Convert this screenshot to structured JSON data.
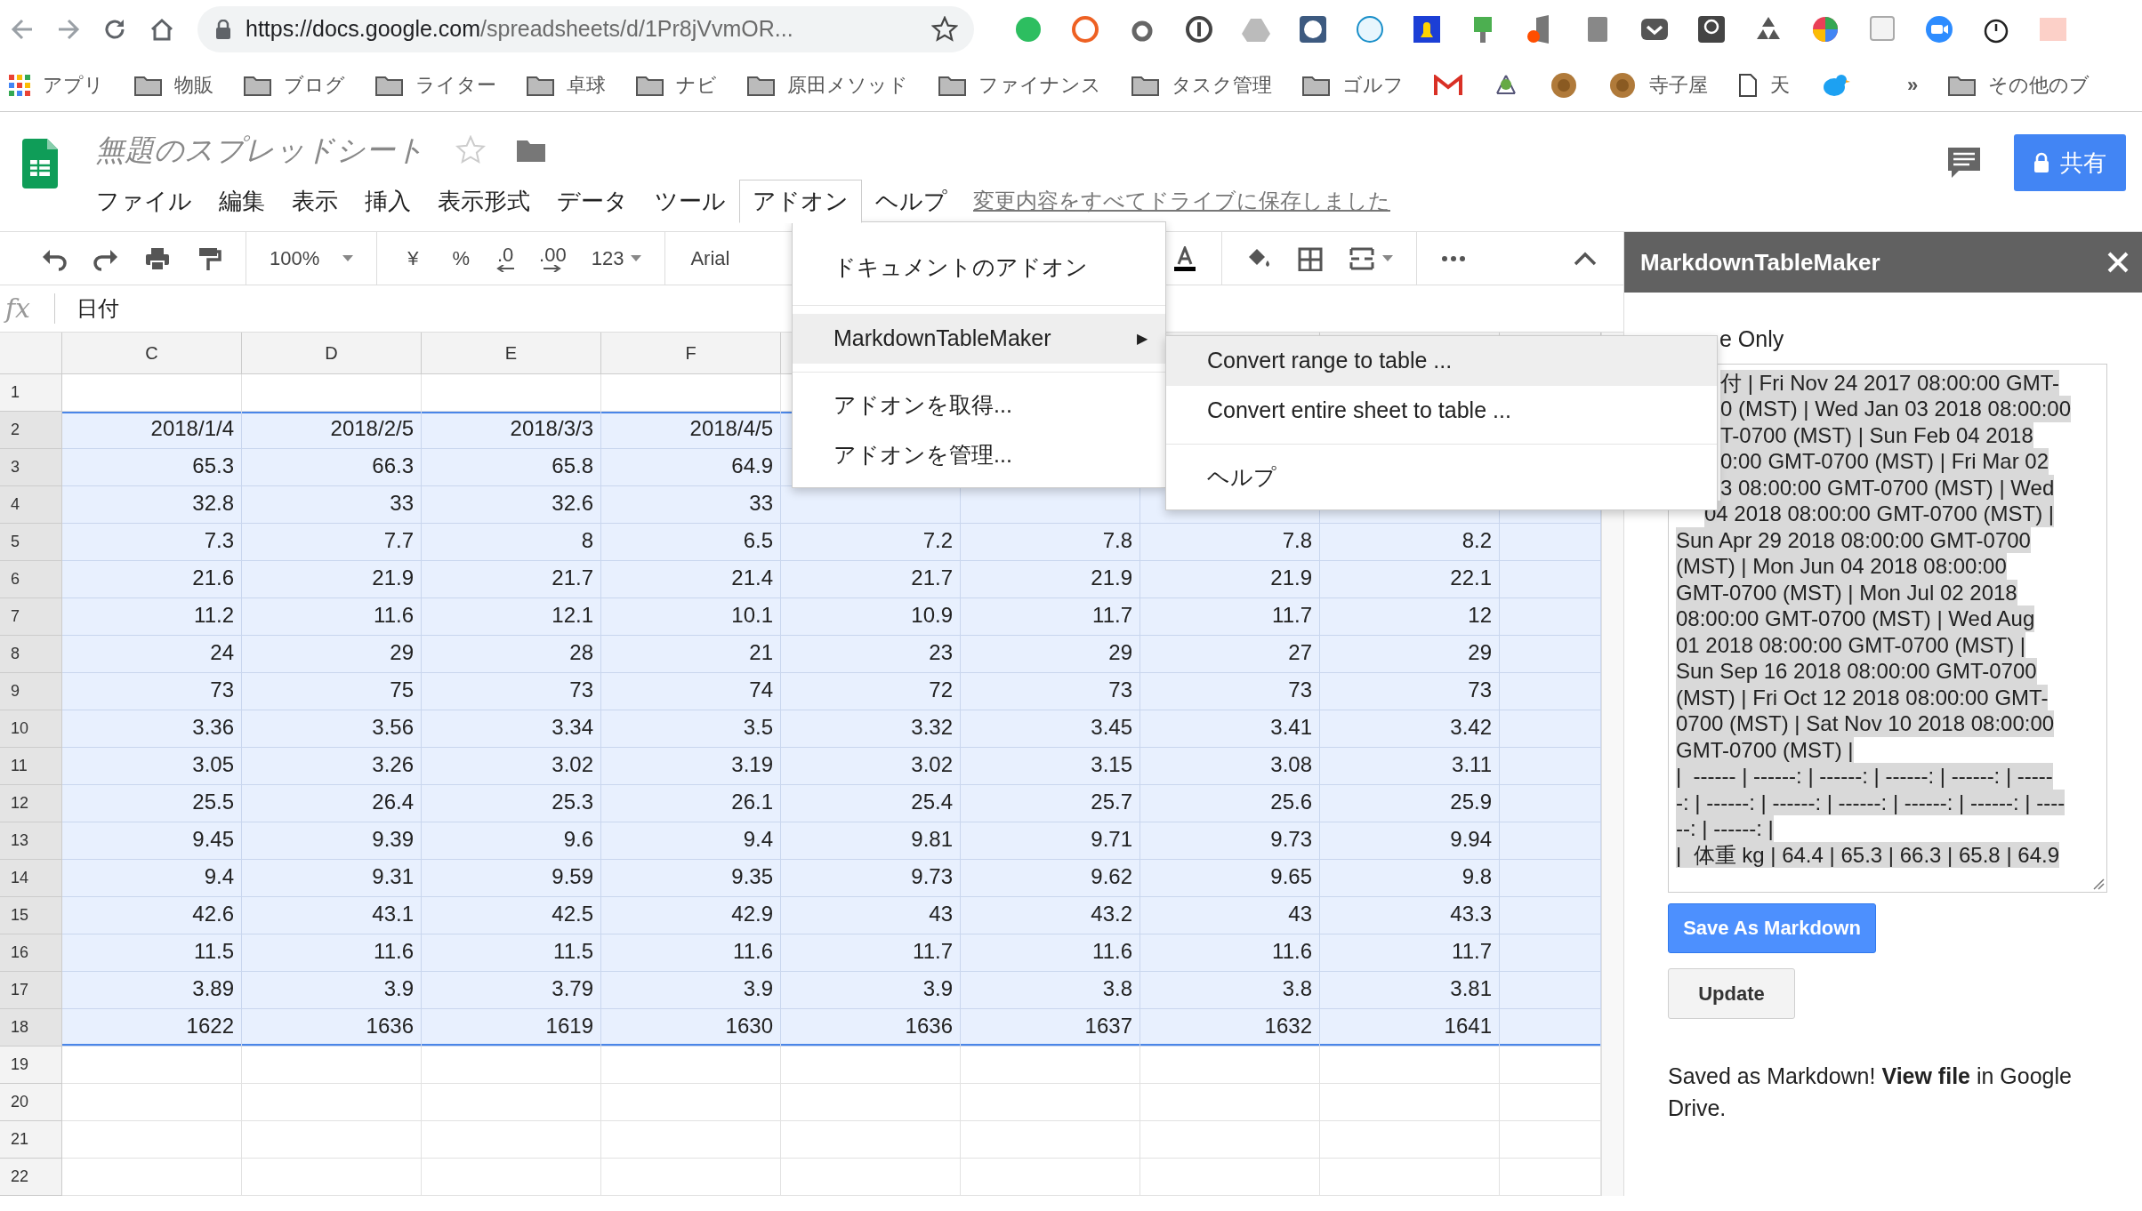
{
  "browser": {
    "url_host": "https://docs.google.com",
    "url_path": "/spreadsheets/d/1Pr8jVvmOR..."
  },
  "bookmarks": [
    {
      "kind": "apps",
      "label": "アプリ"
    },
    {
      "kind": "folder",
      "label": "物販"
    },
    {
      "kind": "folder",
      "label": "ブログ"
    },
    {
      "kind": "folder",
      "label": "ライター"
    },
    {
      "kind": "folder",
      "label": "卓球"
    },
    {
      "kind": "folder",
      "label": "ナビ"
    },
    {
      "kind": "folder",
      "label": "原田メソッド"
    },
    {
      "kind": "folder",
      "label": "ファイナンス"
    },
    {
      "kind": "folder",
      "label": "タスク管理"
    },
    {
      "kind": "folder",
      "label": "ゴルフ"
    },
    {
      "kind": "mail"
    },
    {
      "kind": "node"
    },
    {
      "kind": "coin"
    },
    {
      "kind": "coin",
      "label": "寺子屋"
    },
    {
      "kind": "page",
      "label": "天"
    },
    {
      "kind": "bird"
    },
    {
      "kind": "more",
      "label": "»"
    },
    {
      "kind": "folder",
      "label": "その他のブ"
    }
  ],
  "document": {
    "title": "無題のスプレッドシート",
    "save_status": "変更内容をすべてドライブに保存しました",
    "share_label": "共有"
  },
  "menu": [
    {
      "label": "ファイル",
      "selected": false
    },
    {
      "label": "編集",
      "selected": false
    },
    {
      "label": "表示",
      "selected": false
    },
    {
      "label": "挿入",
      "selected": false
    },
    {
      "label": "表示形式",
      "selected": false
    },
    {
      "label": "データ",
      "selected": false
    },
    {
      "label": "ツール",
      "selected": false
    },
    {
      "label": "アドオン",
      "selected": true
    },
    {
      "label": "ヘルプ",
      "selected": false
    }
  ],
  "toolbar": {
    "zoom": "100%",
    "currency": "¥",
    "percent": "%",
    "decrease_decimals": ".0",
    "increase_decimals": ".00",
    "number_format": "123",
    "font": "Arial"
  },
  "formula_bar": {
    "fx": "fx",
    "value": "日付"
  },
  "sheet": {
    "columns": [
      "C",
      "D",
      "E",
      "F"
    ],
    "rows": [
      {
        "number": "1",
        "selected": false,
        "cells": []
      },
      {
        "number": "2",
        "selected": true,
        "cells": [
          "2018/1/4",
          "2018/2/5",
          "2018/3/3",
          "2018/4/5"
        ]
      },
      {
        "number": "3",
        "selected": true,
        "cells": [
          "65.3",
          "66.3",
          "65.8",
          "64.9"
        ]
      },
      {
        "number": "4",
        "selected": true,
        "cells": [
          "32.8",
          "33",
          "32.6",
          "33"
        ]
      },
      {
        "number": "5",
        "selected": true,
        "cells": [
          "7.3",
          "7.7",
          "8",
          "6.5",
          "7.2",
          "7.8",
          "7.8",
          "8.2"
        ]
      },
      {
        "number": "6",
        "selected": true,
        "cells": [
          "21.6",
          "21.9",
          "21.7",
          "21.4",
          "21.7",
          "21.9",
          "21.9",
          "22.1"
        ]
      },
      {
        "number": "7",
        "selected": true,
        "cells": [
          "11.2",
          "11.6",
          "12.1",
          "10.1",
          "10.9",
          "11.7",
          "11.7",
          "12"
        ]
      },
      {
        "number": "8",
        "selected": true,
        "cells": [
          "24",
          "29",
          "28",
          "21",
          "23",
          "29",
          "27",
          "29"
        ]
      },
      {
        "number": "9",
        "selected": true,
        "cells": [
          "73",
          "75",
          "73",
          "74",
          "72",
          "73",
          "73",
          "73"
        ]
      },
      {
        "number": "10",
        "selected": true,
        "cells": [
          "3.36",
          "3.56",
          "3.34",
          "3.5",
          "3.32",
          "3.45",
          "3.41",
          "3.42"
        ]
      },
      {
        "number": "11",
        "selected": true,
        "cells": [
          "3.05",
          "3.26",
          "3.02",
          "3.19",
          "3.02",
          "3.15",
          "3.08",
          "3.11"
        ]
      },
      {
        "number": "12",
        "selected": true,
        "cells": [
          "25.5",
          "26.4",
          "25.3",
          "26.1",
          "25.4",
          "25.7",
          "25.6",
          "25.9"
        ]
      },
      {
        "number": "13",
        "selected": true,
        "cells": [
          "9.45",
          "9.39",
          "9.6",
          "9.4",
          "9.81",
          "9.71",
          "9.73",
          "9.94"
        ]
      },
      {
        "number": "14",
        "selected": true,
        "cells": [
          "9.4",
          "9.31",
          "9.59",
          "9.35",
          "9.73",
          "9.62",
          "9.65",
          "9.8"
        ]
      },
      {
        "number": "15",
        "selected": true,
        "cells": [
          "42.6",
          "43.1",
          "42.5",
          "42.9",
          "43",
          "43.2",
          "43",
          "43.3"
        ]
      },
      {
        "number": "16",
        "selected": true,
        "cells": [
          "11.5",
          "11.6",
          "11.5",
          "11.6",
          "11.7",
          "11.6",
          "11.6",
          "11.7"
        ]
      },
      {
        "number": "17",
        "selected": true,
        "cells": [
          "3.89",
          "3.9",
          "3.79",
          "3.9",
          "3.9",
          "3.8",
          "3.8",
          "3.81"
        ]
      },
      {
        "number": "18",
        "selected": true,
        "cells": [
          "1622",
          "1636",
          "1619",
          "1630",
          "1636",
          "1637",
          "1632",
          "1641"
        ]
      },
      {
        "number": "19",
        "selected": false,
        "cells": []
      },
      {
        "number": "20",
        "selected": false,
        "cells": []
      },
      {
        "number": "21",
        "selected": false,
        "cells": []
      },
      {
        "number": "22",
        "selected": false,
        "cells": []
      }
    ]
  },
  "addon_menu": [
    {
      "kind": "item",
      "label": "ドキュメントのアドオン",
      "selected": false
    },
    {
      "kind": "divider"
    },
    {
      "kind": "submenu",
      "label": "MarkdownTableMaker",
      "arrow": "▶",
      "selected": true
    },
    {
      "kind": "divider"
    },
    {
      "kind": "item",
      "label": "アドオンを取得...",
      "selected": false
    },
    {
      "kind": "item",
      "label": "アドオンを管理...",
      "selected": false
    }
  ],
  "submenu": [
    {
      "kind": "item",
      "label": "Convert range to table ...",
      "selected": true
    },
    {
      "kind": "item",
      "label": "Convert entire sheet to table ...",
      "selected": false
    },
    {
      "kind": "divider"
    },
    {
      "kind": "item",
      "label": "ヘルプ",
      "selected": false
    }
  ],
  "sidebar": {
    "title": "MarkdownTableMaker",
    "option_label": "e Only",
    "markdown_lines": [
      {
        "text": "付 | Fri Nov 24 2017 08:00:00 GMT-",
        "cut": true
      },
      {
        "text": "0 (MST) | Wed Jan 03 2018 08:00:00",
        "cut": true
      },
      {
        "text": "T-0700 (MST) | Sun Feb 04 2018",
        "cut": true
      },
      {
        "text": "0:00 GMT-0700 (MST) | Fri Mar 02",
        "cut": true
      },
      {
        "text": "3 08:00:00 GMT-0700 (MST) | Wed",
        "cut": true
      },
      {
        "text": "04 2018 08:00:00 GMT-0700 (MST) |",
        "cut": true
      },
      {
        "text": "Sun Apr 29 2018 08:00:00 GMT-0700"
      },
      {
        "text": "(MST) | Mon Jun 04 2018 08:00:00"
      },
      {
        "text": "GMT-0700 (MST) | Mon Jul 02 2018"
      },
      {
        "text": "08:00:00 GMT-0700 (MST) | Wed Aug"
      },
      {
        "text": "01 2018 08:00:00 GMT-0700 (MST) |"
      },
      {
        "text": "Sun Sep 16 2018 08:00:00 GMT-0700"
      },
      {
        "text": "(MST) | Fri Oct 12 2018 08:00:00 GMT-"
      },
      {
        "text": "0700 (MST) | Sat Nov 10 2018 08:00:00"
      },
      {
        "text": "GMT-0700 (MST) |"
      },
      {
        "text": "|  ------ | ------: | ------: | ------: | ------: | -----"
      },
      {
        "text": "-: | ------: | ------: | ------: | ------: | ------: | ----"
      },
      {
        "text": "--: | ------: |"
      },
      {
        "text": "|  体重 kg | 64.4 | 65.3 | 66.3 | 65.8 | 64.9"
      }
    ],
    "buttons": [
      {
        "kind": "primary",
        "label": "Save As Markdown"
      },
      {
        "kind": "secondary",
        "label": "Update"
      }
    ],
    "message_before": "Saved as Markdown!",
    "link": "View file",
    "message_after": "in Google Drive."
  }
}
